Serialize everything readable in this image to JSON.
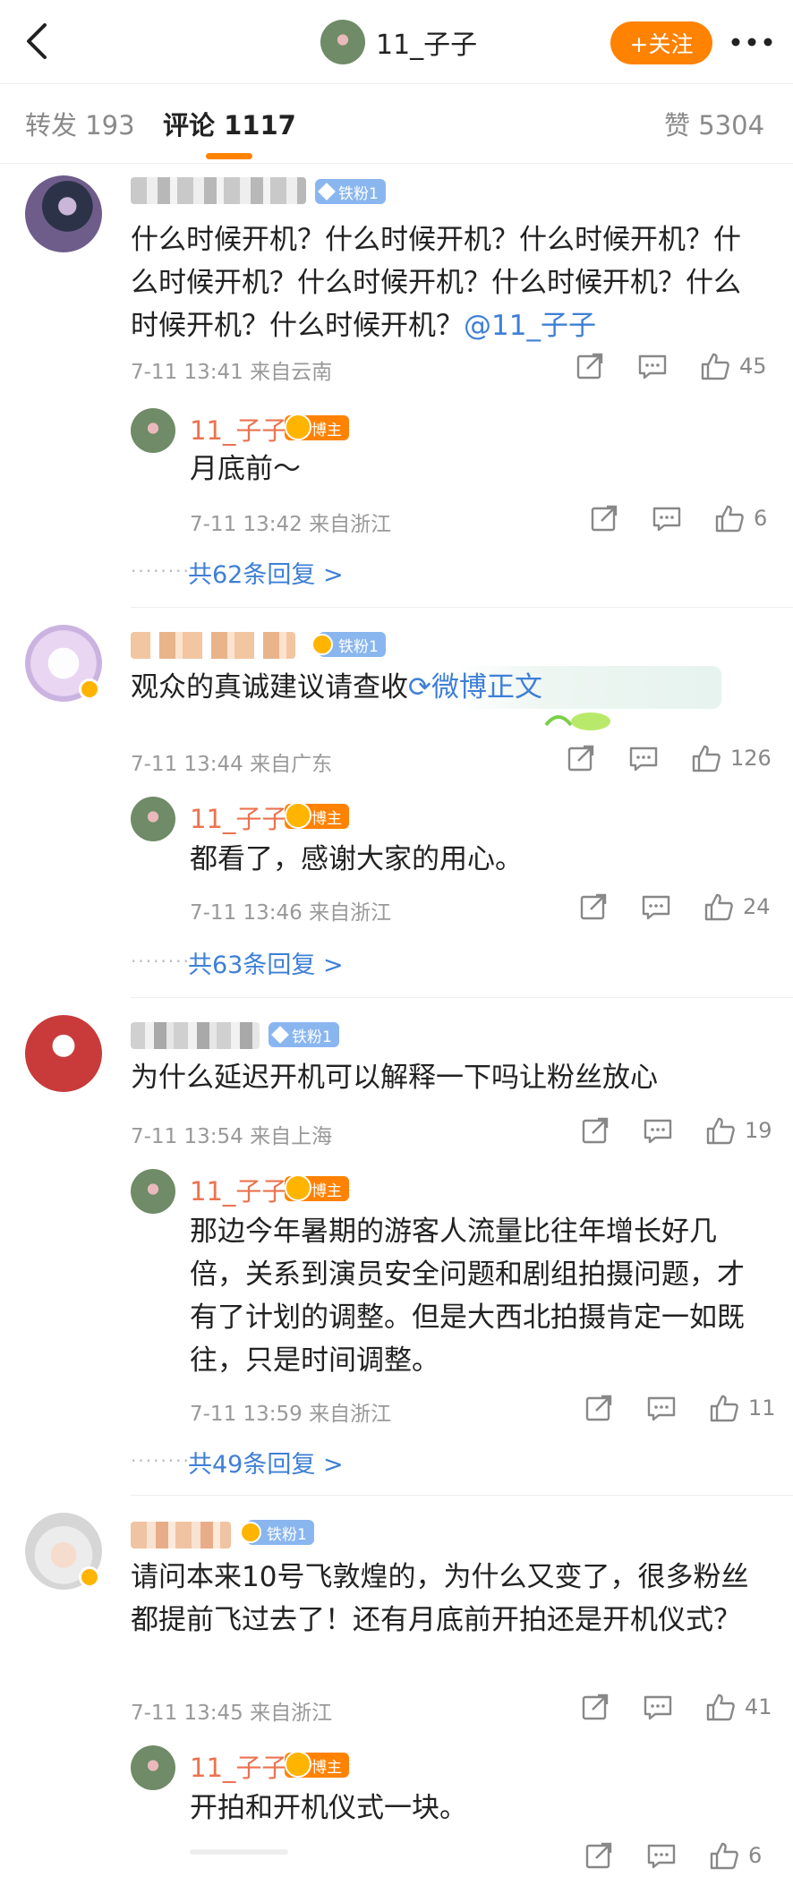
{
  "header": {
    "back_icon": "chevron-left-icon",
    "title": "11_子子",
    "follow_label": "+关注",
    "more_icon": "more-dots-icon"
  },
  "tabs": {
    "repost": "转发 193",
    "comments": "评论 1117",
    "likes": "赞 5304"
  },
  "accent": "#ff8200",
  "link_color": "#3e7fd6",
  "comments": [
    {
      "fan_badge": "铁粉1",
      "text": "什么时候开机？什么时候开机？什么时候开机？什么时候开机？什么时候开机？什么时候开机？什么时候开机？什么时候开机？",
      "mention": "@11_子子",
      "meta": "7-11 13:41 来自云南",
      "likes": "45",
      "reply": {
        "nick": "11_子子",
        "badge": "博主",
        "text": "月底前～",
        "meta": "7-11 13:42 来自浙江",
        "likes": "6"
      },
      "more_replies": "共62条回复 >"
    },
    {
      "fan_badge": "铁粉1",
      "text": "观众的真诚建议请查收",
      "link_text": "微博正文",
      "meta": "7-11 13:44 来自广东",
      "likes": "126",
      "reply": {
        "nick": "11_子子",
        "badge": "博主",
        "text": "都看了，感谢大家的用心。",
        "meta": "7-11 13:46 来自浙江",
        "likes": "24"
      },
      "more_replies": "共63条回复 >"
    },
    {
      "fan_badge": "铁粉1",
      "text": "为什么延迟开机可以解释一下吗让粉丝放心",
      "meta": "7-11 13:54 来自上海",
      "likes": "19",
      "reply": {
        "nick": "11_子子",
        "badge": "博主",
        "text": "那边今年暑期的游客人流量比往年增长好几倍，关系到演员安全问题和剧组拍摄问题，才有了计划的调整。但是大西北拍摄肯定一如既往，只是时间调整。",
        "meta": "7-11 13:59 来自浙江",
        "likes": "11"
      },
      "more_replies": "共49条回复 >"
    },
    {
      "fan_badge": "铁粉1",
      "text": "请问本来10号飞敦煌的，为什么又变了，很多粉丝都提前飞过去了！还有月底前开拍还是开机仪式？",
      "meta": "7-11 13:45 来自浙江",
      "likes": "41",
      "reply": {
        "nick": "11_子子",
        "badge": "博主",
        "text": "开拍和开机仪式一块。",
        "likes": "6"
      }
    }
  ]
}
